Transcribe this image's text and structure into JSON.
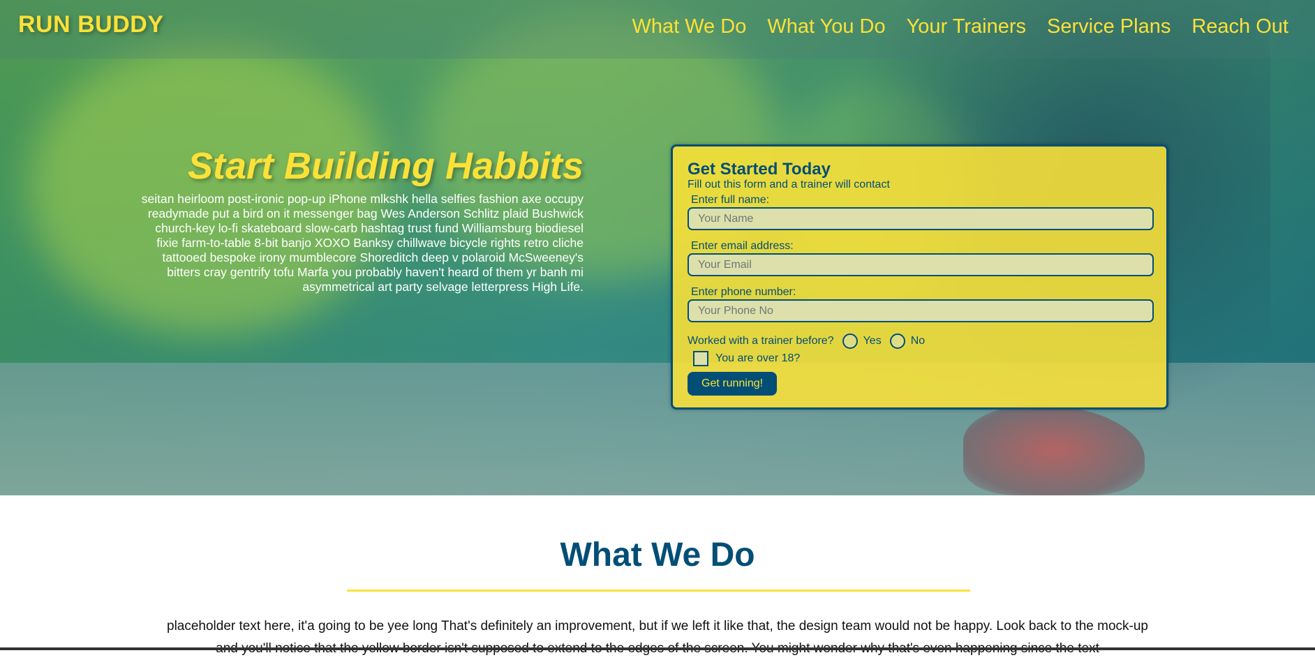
{
  "header": {
    "logo": "RUN BUDDY",
    "nav": [
      "What We Do",
      "What You Do",
      "Your Trainers",
      "Service Plans",
      "Reach Out"
    ]
  },
  "hero": {
    "title": "Start Building Habbits",
    "body": "seitan heirloom post-ironic pop-up iPhone mlkshk hella selfies fashion axe occupy readymade put a bird on it messenger bag Wes Anderson Schlitz plaid Bushwick church-key lo-fi skateboard slow-carb hashtag trust fund Williamsburg biodiesel fixie farm-to-table 8-bit banjo XOXO Banksy chillwave bicycle rights retro cliche tattooed bespoke irony mumblecore Shoreditch deep v polaroid McSweeney's bitters cray gentrify tofu Marfa you probably haven't heard of them yr banh mi asymmetrical art party selvage letterpress High Life."
  },
  "form": {
    "title": "Get Started Today",
    "subtitle": "Fill out this form and a trainer will contact",
    "name_label": "Enter full name:",
    "name_placeholder": "Your Name",
    "email_label": "Enter email address:",
    "email_placeholder": "Your Email",
    "phone_label": "Enter phone number:",
    "phone_placeholder": "Your Phone No",
    "trainer_question": "Worked with a trainer before?",
    "yes_label": "Yes",
    "no_label": "No",
    "age_check_label": "You are over 18?",
    "submit_label": "Get running!"
  },
  "what_we_do": {
    "title": "What We Do",
    "body": "placeholder text here, it'a going to be yee long That's definitely an improvement, but if we left it like that, the design team would not be happy. Look back to the mock-up and you'll notice that the yellow border isn't supposed to extend to the edges of the screen. You might wonder why that's even happening since the text"
  },
  "colors": {
    "brand_yellow": "#fce138",
    "brand_blue": "#024e76"
  }
}
